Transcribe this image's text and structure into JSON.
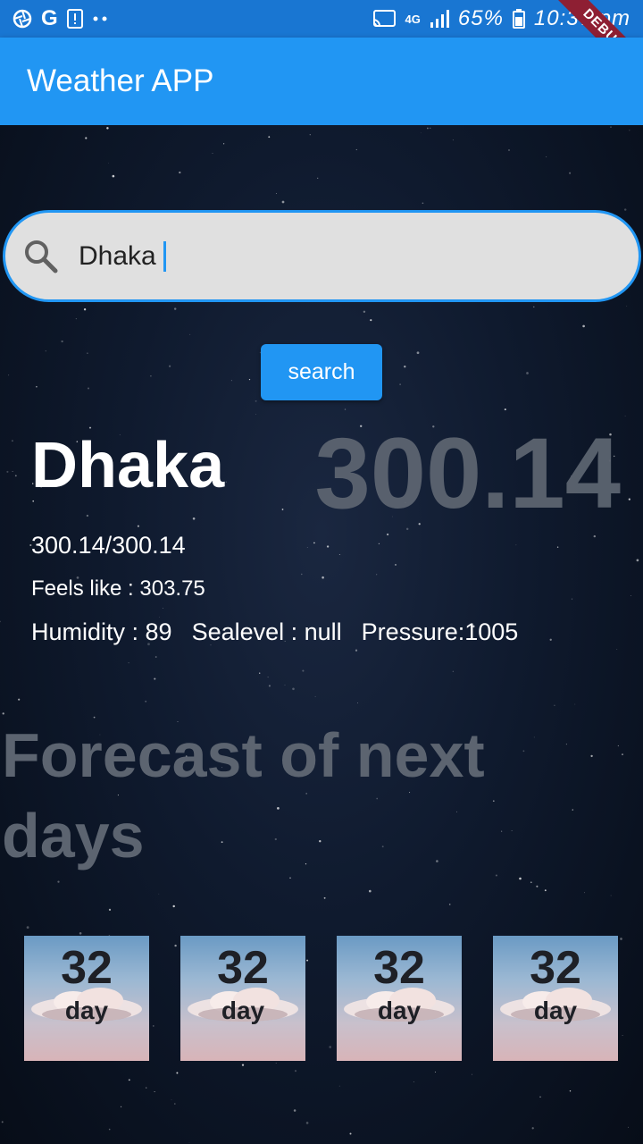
{
  "status_bar": {
    "left_icons": [
      "aperture-icon",
      "google-icon",
      "alert-icon",
      "more-dots-icon"
    ],
    "network": "4G",
    "battery": "65%",
    "time": "10:37 pm",
    "debug_label": "DEBUG"
  },
  "app_bar": {
    "title": "Weather APP",
    "color": "#2196f3"
  },
  "search": {
    "value": "Dhaka",
    "button_label": "search"
  },
  "current": {
    "city": "Dhaka",
    "temp": "300.14",
    "range": "300.14/300.14",
    "feels_like": "Feels like : 303.75",
    "humidity": "Humidity : 89",
    "sealevel": "Sealevel : null",
    "pressure": "Pressure:1005"
  },
  "forecast": {
    "title": "Forecast of next days",
    "days": [
      {
        "temp": "32",
        "label": "day"
      },
      {
        "temp": "32",
        "label": "day"
      },
      {
        "temp": "32",
        "label": "day"
      },
      {
        "temp": "32",
        "label": "day"
      }
    ]
  }
}
